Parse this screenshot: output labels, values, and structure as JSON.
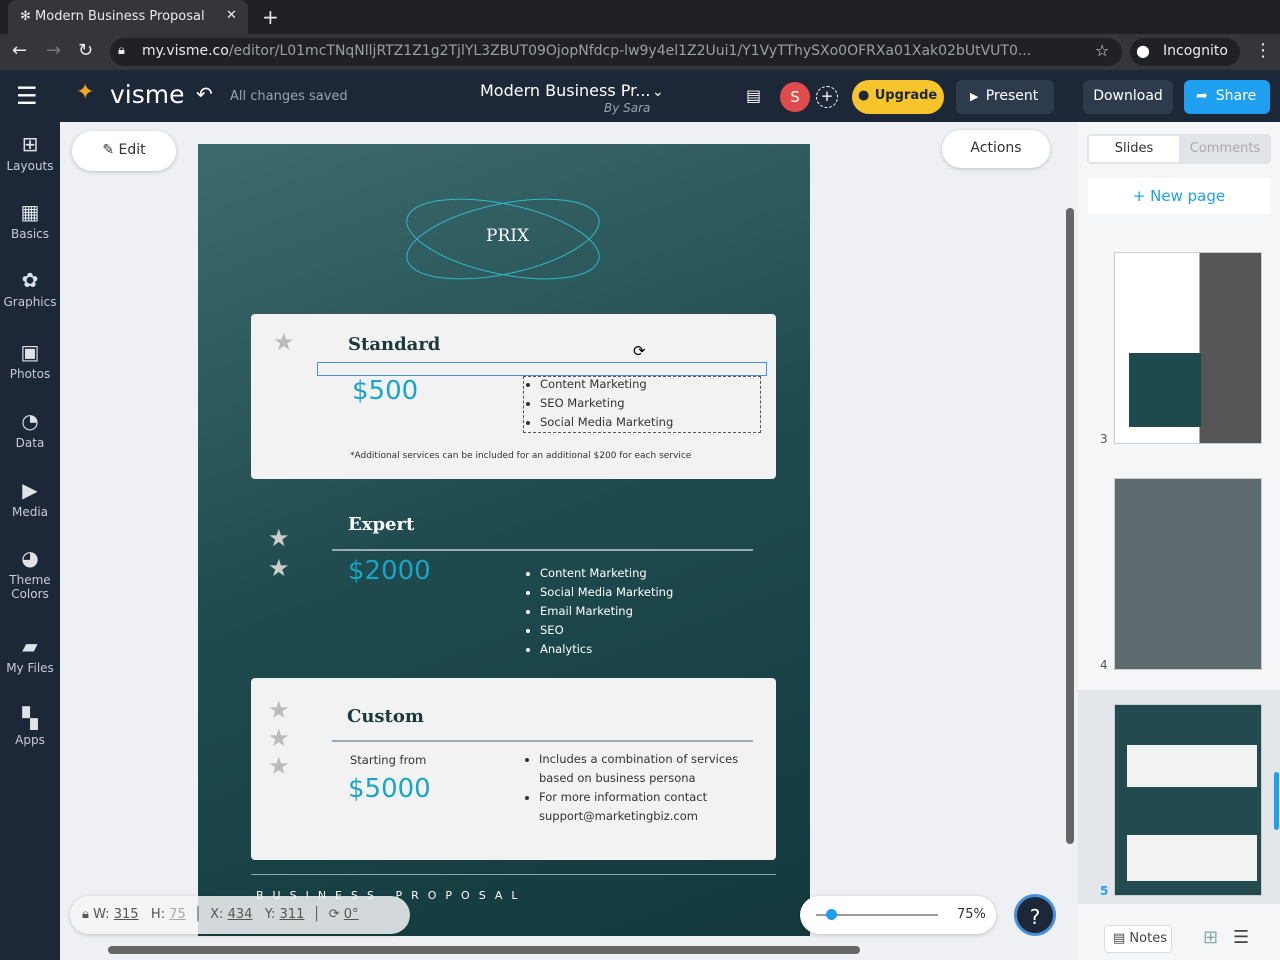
{
  "browser": {
    "tab_title": "Modern Business Proposal",
    "url_host": "my.visme.co",
    "url_path": "/editor/L01mcTNqNlljRTZ1Z1g2TjlYL3ZBUT09OjopNfdcp-lw9y4el1Z2Uui1/Y1VyTThySXo0OFRXa01Xak02bUtVUT0...",
    "profile": "Incognito"
  },
  "topbar": {
    "logo": "visme",
    "save_status": "All changes saved",
    "doc_title": "Modern Business Pr...",
    "author": "By Sara",
    "avatar": "S",
    "upgrade": "Upgrade",
    "present": "Present",
    "download": "Download",
    "share": "Share"
  },
  "sidebar": {
    "items": [
      {
        "label": "Layouts",
        "icon": "layout-icon"
      },
      {
        "label": "Basics",
        "icon": "shapes-icon"
      },
      {
        "label": "Graphics",
        "icon": "graphics-icon"
      },
      {
        "label": "Photos",
        "icon": "image-icon"
      },
      {
        "label": "Data",
        "icon": "pie-chart-icon"
      },
      {
        "label": "Media",
        "icon": "video-icon"
      },
      {
        "label": "Theme Colors",
        "icon": "palette-icon"
      },
      {
        "label": "My Files",
        "icon": "folder-icon"
      },
      {
        "label": "Apps",
        "icon": "grid-icon"
      }
    ]
  },
  "canvas": {
    "edit": "Edit",
    "actions": "Actions",
    "zoom": "75%",
    "zoom_fraction": 0.08,
    "help": "?"
  },
  "slide": {
    "heading": "PRIX",
    "standard": {
      "title": "Standard",
      "price": "$500",
      "items": [
        "Content Marketing",
        "SEO Marketing",
        "Social Media Marketing"
      ],
      "note": "*Additional services can be included for an additional $200 for each service"
    },
    "expert": {
      "title": "Expert",
      "price": "$2000",
      "items": [
        "Content Marketing",
        "Social Media Marketing",
        "Email Marketing",
        "SEO",
        "Analytics"
      ]
    },
    "custom": {
      "title": "Custom",
      "from": "Starting from",
      "price": "$5000",
      "items": [
        "Includes a combination of services based on business persona",
        "For more information contact support@marketingbiz.com"
      ]
    },
    "footer": "BUSINESS PROPOSAL"
  },
  "props": {
    "w_label": "W:",
    "w": "315",
    "h_label": "H:",
    "h": "75",
    "x_label": "X:",
    "x": "434",
    "y_label": "Y:",
    "y": "311",
    "rot": "0°"
  },
  "panel": {
    "tab_slides": "Slides",
    "tab_comments": "Comments",
    "new_page": "+ New page",
    "pages": [
      "3",
      "4",
      "5"
    ],
    "notes": "Notes"
  }
}
